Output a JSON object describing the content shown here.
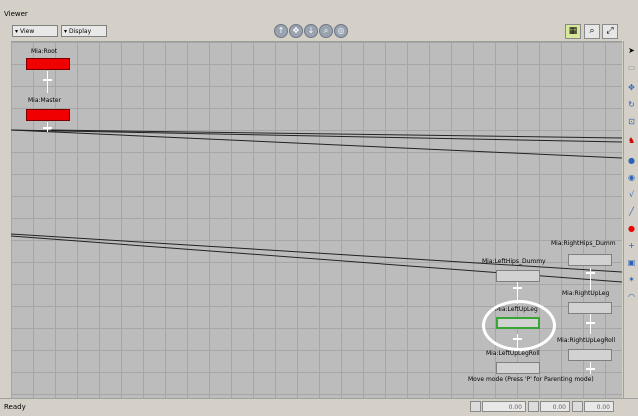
{
  "window": {
    "title": "Viewer"
  },
  "toolbar": {
    "view_label": "View",
    "display_label": "Display",
    "nav_icons": [
      "pan-up-icon",
      "move-icon",
      "pan-down-icon",
      "zoom-icon",
      "frame-icon"
    ]
  },
  "nodes": {
    "root": {
      "label": "Mia:Root"
    },
    "master": {
      "label": "Mia:Master"
    },
    "left_hips": {
      "label": "Mia:LeftHips_Dummy"
    },
    "left_upleg": {
      "label": "Mia:LeftUpLeg"
    },
    "left_uplegroll": {
      "label": "Mia:LeftUpLegRoll"
    },
    "right_hips": {
      "label": "Mia:RightHips_Dumm"
    },
    "right_upleg": {
      "label": "Mia:RightUpLeg"
    },
    "right_uplegroll": {
      "label": "Mia:RightUpLegRoll"
    }
  },
  "hint": "Move mode (Press 'P' for Parenting mode)",
  "status": {
    "text": "Ready"
  },
  "fields": [
    "0.00",
    "0.00",
    "0.00"
  ],
  "colors": {
    "selected_node": "#f00000",
    "highlight": "#37a537",
    "grid_bg": "#bcbcbc"
  }
}
